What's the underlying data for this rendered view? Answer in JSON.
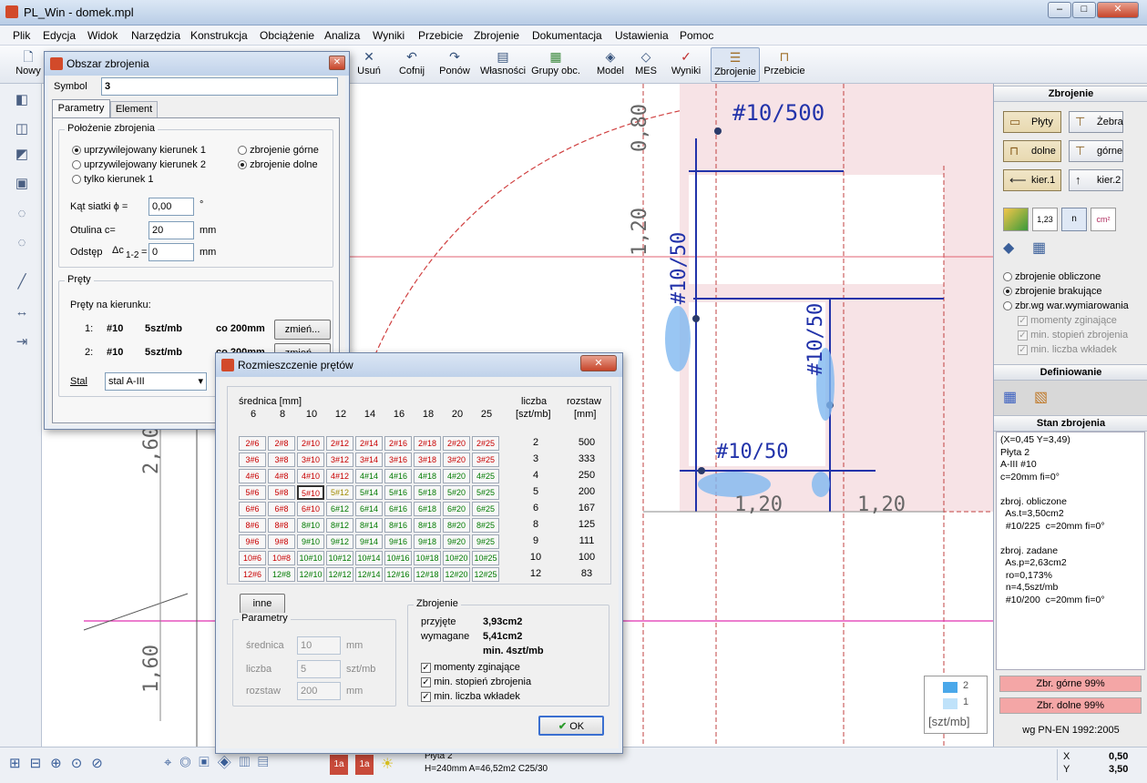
{
  "app": {
    "title": "PL_Win - domek.mpl"
  },
  "menu": [
    "Plik",
    "Edycja",
    "Widok",
    "Narzędzia",
    "Konstrukcja",
    "Obciążenie",
    "Analiza",
    "Wyniki",
    "Przebicie",
    "Zbrojenie",
    "Dokumentacja",
    "Ustawienia",
    "Pomoc"
  ],
  "toolbar": {
    "new": "Nowy",
    "delete": "Usuń",
    "undo": "Cofnij",
    "redo": "Ponów",
    "props": "Własności",
    "groups": "Grupy obc.",
    "model": "Model",
    "mes": "MES",
    "results": "Wyniki",
    "reinf": "Zbrojenie",
    "punch": "Przebicie"
  },
  "canvas": {
    "dims": [
      "0,80",
      "1,20",
      "#10/500",
      "#10/50",
      "#10/50",
      "#10/50",
      "1,20",
      "1,20",
      "2,60",
      "1,60",
      "#10/50"
    ],
    "legend": {
      "v2": "2",
      "v1": "1",
      "unit": "[szt/mb]"
    }
  },
  "right": {
    "title": "Zbrojenie",
    "btn_plates": "Płyty",
    "btn_ribs": "Żebra",
    "btn_bottom": "dolne",
    "btn_top": "górne",
    "btn_dir1": "kier.1",
    "btn_dir2": "kier.2",
    "icons": [
      "1,23",
      "n",
      "cm²"
    ],
    "radio_calc": "zbrojenie obliczone",
    "radio_missing": "zbrojenie brakujące",
    "radio_dim": "zbr.wg war.wymiarowania",
    "chk_moments": "momenty zginające",
    "chk_degree": "min. stopień zbrojenia",
    "chk_count": "min. liczba wkładek",
    "defining": "Definiowanie",
    "state_title": "Stan zbrojenia",
    "state_lines": [
      "(X=0,45 Y=3,49)",
      "Płyta 2",
      "A-III #10",
      "c=20mm fi=0°",
      "",
      "zbroj. obliczone",
      "  As.t=3,50cm2",
      "  #10/225  c=20mm fi=0°",
      "",
      "zbroj. zadane",
      "  As.p=2,63cm2",
      "  ro=0,173%",
      "  n=4,5szt/mb",
      "  #10/200  c=20mm fi=0°"
    ],
    "top_pct": "Zbr. górne 99%",
    "bottom_pct": "Zbr. dolne 99%",
    "norm": "wg PN-EN 1992:2005",
    "colors": {
      "top": "#f4a6a6",
      "bottom": "#f4a6a6"
    }
  },
  "status": {
    "plate": "Płyta 2",
    "info": "H=240mm A=46,52m2 C25/30",
    "x_label": "X",
    "x_val": "0,50",
    "y_label": "Y",
    "y_val": "3,50"
  },
  "dlg1": {
    "title": "Obszar zbrojenia",
    "symbol_label": "Symbol",
    "symbol_value": "3",
    "tab_params": "Parametry",
    "tab_element": "Element",
    "grp_position": "Położenie zbrojenia",
    "r_pref1": "uprzywilejowany kierunek 1",
    "r_pref2": "uprzywilejowany kierunek 2",
    "r_only1": "tylko kierunek 1",
    "r_top": "zbrojenie górne",
    "r_bottom": "zbrojenie dolne",
    "angle_label": "Kąt siatki ϕ =",
    "angle_value": "0,00",
    "angle_unit": "°",
    "cover_label": "Otulina    c=",
    "cover_value": "20",
    "cover_unit": "mm",
    "gap_label": "Odstęp",
    "gap_sym": "Δc",
    "gap_sub": "1-2",
    "gap_eq": "=",
    "gap_value": "0",
    "gap_unit": "mm",
    "grp_bars": "Pręty",
    "bars_dir": "Pręty na kierunku:",
    "row1": {
      "n": "1:",
      "d": "#10",
      "cnt": "5szt/mb",
      "sp": "co 200mm",
      "btn": "zmień..."
    },
    "row2": {
      "n": "2:",
      "d": "#10",
      "cnt": "5szt/mb",
      "sp": "co 200mm",
      "btn": "zmień..."
    },
    "steel_label": "Stal",
    "steel_value": "stal A-III"
  },
  "dlg2": {
    "title": "Rozmieszczenie prętów",
    "diam_header": "średnica [mm]",
    "count_header": "liczba",
    "count_unit": "[szt/mb]",
    "spacing_header": "rozstaw",
    "spacing_unit": "[mm]",
    "diameters": [
      "6",
      "8",
      "10",
      "12",
      "14",
      "16",
      "18",
      "20",
      "25"
    ],
    "counts": [
      "2",
      "3",
      "4",
      "5",
      "6",
      "8",
      "9",
      "10",
      "12"
    ],
    "spacings": [
      "500",
      "333",
      "250",
      "200",
      "167",
      "125",
      "111",
      "100",
      "83"
    ],
    "cells": [
      [
        "2#6",
        "2#8",
        "2#10",
        "2#12",
        "2#14",
        "2#16",
        "2#18",
        "2#20",
        "2#25"
      ],
      [
        "3#6",
        "3#8",
        "3#10",
        "3#12",
        "3#14",
        "3#16",
        "3#18",
        "3#20",
        "3#25"
      ],
      [
        "4#6",
        "4#8",
        "4#10",
        "4#12",
        "4#14",
        "4#16",
        "4#18",
        "4#20",
        "4#25"
      ],
      [
        "5#6",
        "5#8",
        "5#10",
        "5#12",
        "5#14",
        "5#16",
        "5#18",
        "5#20",
        "5#25"
      ],
      [
        "6#6",
        "6#8",
        "6#10",
        "6#12",
        "6#14",
        "6#16",
        "6#18",
        "6#20",
        "6#25"
      ],
      [
        "8#6",
        "8#8",
        "8#10",
        "8#12",
        "8#14",
        "8#16",
        "8#18",
        "8#20",
        "8#25"
      ],
      [
        "9#6",
        "9#8",
        "9#10",
        "9#12",
        "9#14",
        "9#16",
        "9#18",
        "9#20",
        "9#25"
      ],
      [
        "10#6",
        "10#8",
        "10#10",
        "10#12",
        "10#14",
        "10#16",
        "10#18",
        "10#20",
        "10#25"
      ],
      [
        "12#6",
        "12#8",
        "12#10",
        "12#12",
        "12#14",
        "12#16",
        "12#18",
        "12#20",
        "12#25"
      ]
    ],
    "cell_status": [
      [
        "r",
        "r",
        "r",
        "r",
        "r",
        "r",
        "r",
        "r",
        "r"
      ],
      [
        "r",
        "r",
        "r",
        "r",
        "r",
        "r",
        "r",
        "r",
        "r"
      ],
      [
        "r",
        "r",
        "r",
        "r",
        "g",
        "g",
        "g",
        "g",
        "g"
      ],
      [
        "r",
        "r",
        "r",
        "y",
        "g",
        "g",
        "g",
        "g",
        "g"
      ],
      [
        "r",
        "r",
        "r",
        "g",
        "g",
        "g",
        "g",
        "g",
        "g"
      ],
      [
        "r",
        "r",
        "g",
        "g",
        "g",
        "g",
        "g",
        "g",
        "g"
      ],
      [
        "r",
        "r",
        "g",
        "g",
        "g",
        "g",
        "g",
        "g",
        "g"
      ],
      [
        "r",
        "r",
        "g",
        "g",
        "g",
        "g",
        "g",
        "g",
        "g"
      ],
      [
        "r",
        "g",
        "g",
        "g",
        "g",
        "g",
        "g",
        "g",
        "g"
      ]
    ],
    "btn_other": "inne",
    "grp_params": "Parametry",
    "p_diam": "średnica",
    "p_diam_val": "10",
    "p_diam_unit": "mm",
    "p_count": "liczba",
    "p_count_val": "5",
    "p_count_unit": "szt/mb",
    "p_spacing": "rozstaw",
    "p_spacing_val": "200",
    "p_spacing_unit": "mm",
    "grp_reinf": "Zbrojenie",
    "accepted_label": "przyjęte",
    "accepted_value": "3,93cm2",
    "required_label": "wymagane",
    "required_value": "5,41cm2",
    "required_min": "min. 4szt/mb",
    "chk1": "momenty zginające",
    "chk2": "min. stopień zbrojenia",
    "chk3": "min. liczba wkładek",
    "ok": "OK"
  }
}
